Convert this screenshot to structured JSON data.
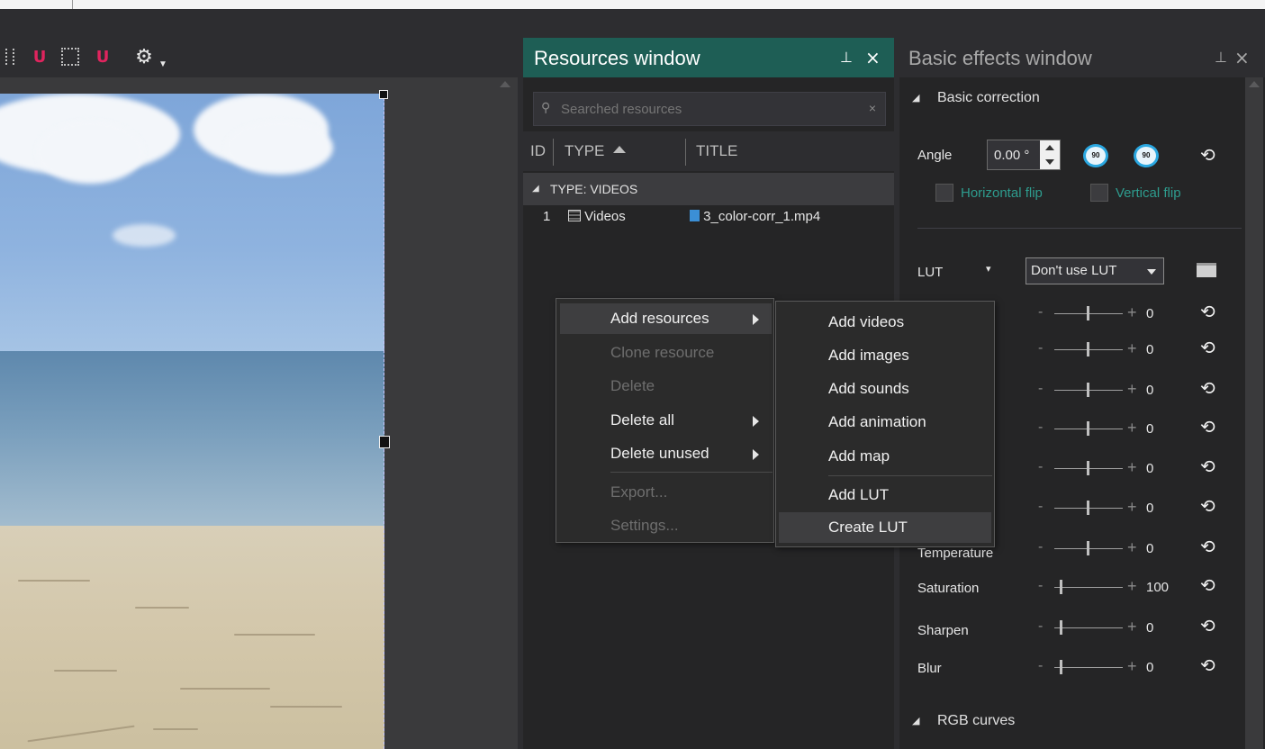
{
  "resources_window": {
    "title": "Resources window",
    "pin": "1",
    "close": "×",
    "search": {
      "placeholder": "Searched resources",
      "clear": "×"
    },
    "columns": {
      "id": "ID",
      "type": "TYPE",
      "title": "TITLE"
    },
    "group": {
      "label": "TYPE: VIDEOS"
    },
    "rows": [
      {
        "id": "1",
        "type": "Videos",
        "title": "3_color-corr_1.mp4"
      }
    ]
  },
  "context_menu": {
    "items": [
      {
        "label": "Add resources",
        "enabled": true,
        "submenu": true
      },
      {
        "label": "Clone resource",
        "enabled": false
      },
      {
        "label": "Delete",
        "enabled": false
      },
      {
        "label": "Delete all",
        "enabled": true,
        "submenu": true
      },
      {
        "label": "Delete unused",
        "enabled": true,
        "submenu": true
      },
      {
        "label": "Export...",
        "enabled": false
      },
      {
        "label": "Settings...",
        "enabled": false
      }
    ]
  },
  "submenu": {
    "items": [
      {
        "label": "Add videos"
      },
      {
        "label": "Add images"
      },
      {
        "label": "Add sounds"
      },
      {
        "label": "Add animation"
      },
      {
        "label": "Add map"
      },
      {
        "label": "Add LUT"
      },
      {
        "label": "Create LUT"
      }
    ]
  },
  "effects_window": {
    "title": "Basic effects window",
    "section_basic": "Basic correction",
    "angle_label": "Angle",
    "angle_value": "0.00 °",
    "rotate_left": "90",
    "rotate_right": "90",
    "hflip_label": "Horizontal flip",
    "vflip_label": "Vertical flip",
    "lut_label": "LUT",
    "lut_value": "Don't use LUT",
    "sliders": [
      {
        "label": "",
        "value": "0"
      },
      {
        "label": "",
        "value": "0"
      },
      {
        "label": "",
        "value": "0"
      },
      {
        "label": "",
        "value": "0"
      },
      {
        "label": "",
        "value": "0"
      },
      {
        "label": "",
        "value": "0"
      },
      {
        "label": "Temperature",
        "value": "0"
      },
      {
        "label": "Saturation",
        "value": "100"
      },
      {
        "label": "Sharpen",
        "value": "0"
      },
      {
        "label": "Blur",
        "value": "0"
      }
    ],
    "section_rgb": "RGB curves"
  },
  "colors": {
    "resources_title_bg": "#1e5e55",
    "accent_teal": "#2e9c8e",
    "magnet_red": "#e0245e",
    "rotate_blue": "#2aa7e0"
  },
  "icons": [
    "magnet-icon",
    "grid-icon",
    "gear-icon",
    "search-icon",
    "pin-icon",
    "close-icon",
    "video-icon",
    "file-icon",
    "rotate-icon",
    "reset-icon",
    "folder-icon"
  ]
}
